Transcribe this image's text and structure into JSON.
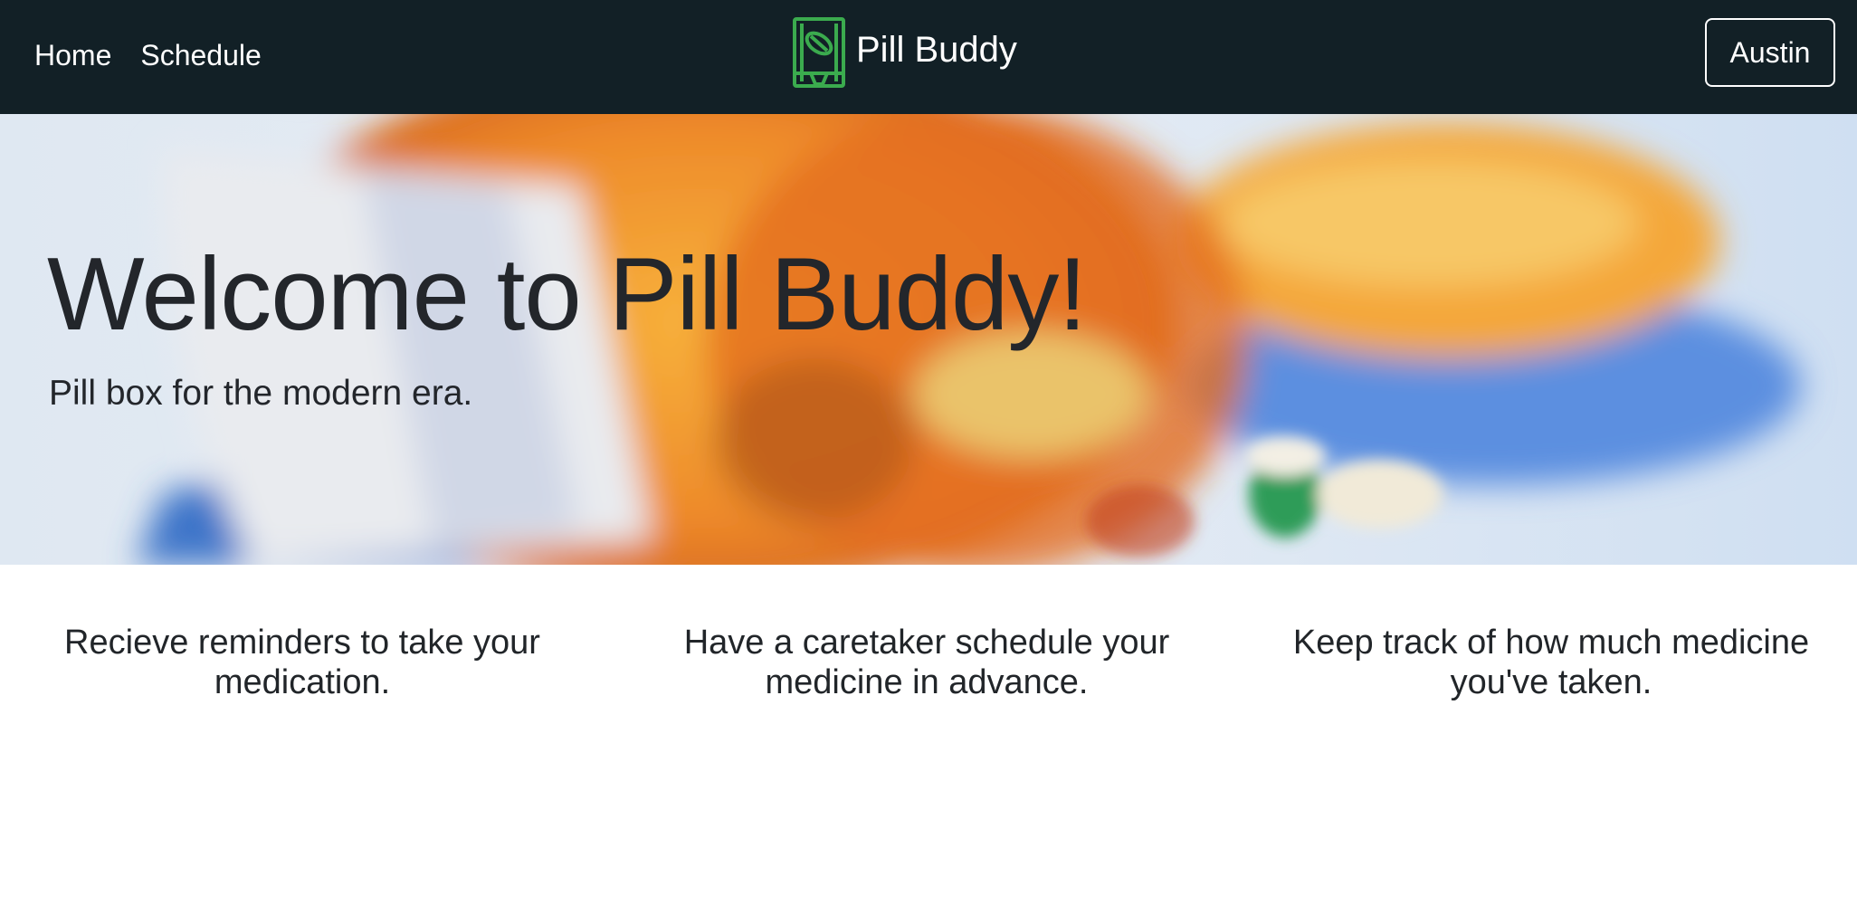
{
  "nav": {
    "links": [
      {
        "label": "Home"
      },
      {
        "label": "Schedule"
      }
    ],
    "brand": "Pill Buddy",
    "brand_icon": "pill-box-icon",
    "user": "Austin"
  },
  "hero": {
    "title": "Welcome to Pill Buddy!",
    "subtitle": "Pill box for the modern era."
  },
  "features": [
    {
      "text": "Recieve reminders to take your medication."
    },
    {
      "text": "Have a caretaker schedule your medicine in advance."
    },
    {
      "text": "Keep track of how much medicine you've taken."
    }
  ],
  "colors": {
    "navbar_bg": "#122026",
    "brand_green": "#3bab4e",
    "text_dark": "#212529"
  }
}
